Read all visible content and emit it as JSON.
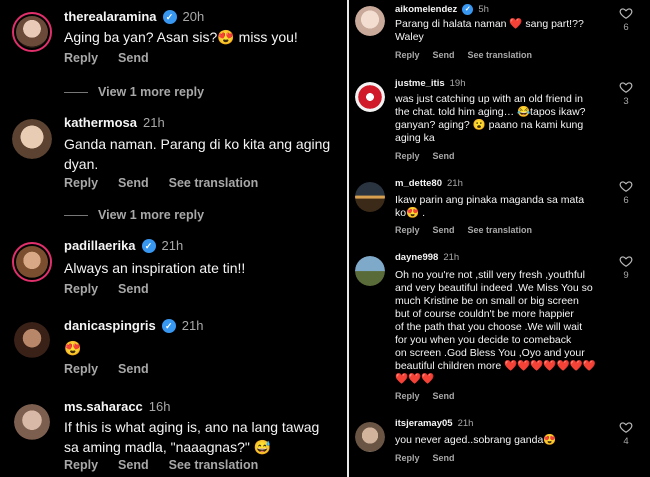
{
  "colors": {
    "background": "#000000",
    "text": "#f5f5f5",
    "muted": "#a8a8a8",
    "verified": "#3897f0",
    "story_ring": "#e1306c"
  },
  "actions": {
    "reply": "Reply",
    "send": "Send",
    "see_translation": "See translation"
  },
  "left": {
    "view_more": "View 1 more reply",
    "comments": [
      {
        "username": "therealaramina",
        "verified": true,
        "time": "20h",
        "text": "Aging ba yan? Asan sis?😍 miss you!"
      },
      {
        "username": "kathermosa",
        "verified": false,
        "time": "21h",
        "text": "Ganda naman. Parang di ko kita ang aging\ndyan."
      },
      {
        "username": "padillaerika",
        "verified": true,
        "time": "21h",
        "text": "Always an inspiration ate tin!!"
      },
      {
        "username": "danicaspingris",
        "verified": true,
        "time": "21h",
        "text": "😍"
      },
      {
        "username": "ms.saharacc",
        "verified": false,
        "time": "16h",
        "text": "If this is what aging is, ano na lang tawag\nsa aming madla, \"naaagnas?\" 😅"
      }
    ]
  },
  "right": {
    "comments": [
      {
        "username": "aikomelendez",
        "verified": true,
        "time": "5h",
        "text": "Parang di halata naman ❤️ sang part!??\nWaley",
        "likes": "6"
      },
      {
        "username": "justme_itis",
        "verified": false,
        "time": "19h",
        "text": "was just catching up with an old friend in\nthe chat. told him aging… 😂tapos ikaw?\nganyan? aging? 😮 paano na kami kung\naging ka",
        "likes": "3"
      },
      {
        "username": "m_dette80",
        "verified": false,
        "time": "21h",
        "text": "Ikaw parin ang  pinaka maganda sa mata\nko😍 .",
        "likes": "6"
      },
      {
        "username": "dayne998",
        "verified": false,
        "time": "21h",
        "text": "Oh no you're not ,still very fresh ,youthful\nand very beautiful indeed .We Miss You so\nmuch  Kristine be on small or big screen\nbut of course couldn't be more happier\nof the path that you choose .We will wait\nfor you when you decide to comeback\non screen .God Bless You ,Oyo and your\nbeautiful children more ❤️❤️❤️❤️❤️❤️❤️\n❤️❤️❤️",
        "likes": "9"
      },
      {
        "username": "itsjeramay05",
        "verified": false,
        "time": "21h",
        "text": "you never aged..sobrang ganda😍",
        "likes": "4"
      }
    ]
  }
}
